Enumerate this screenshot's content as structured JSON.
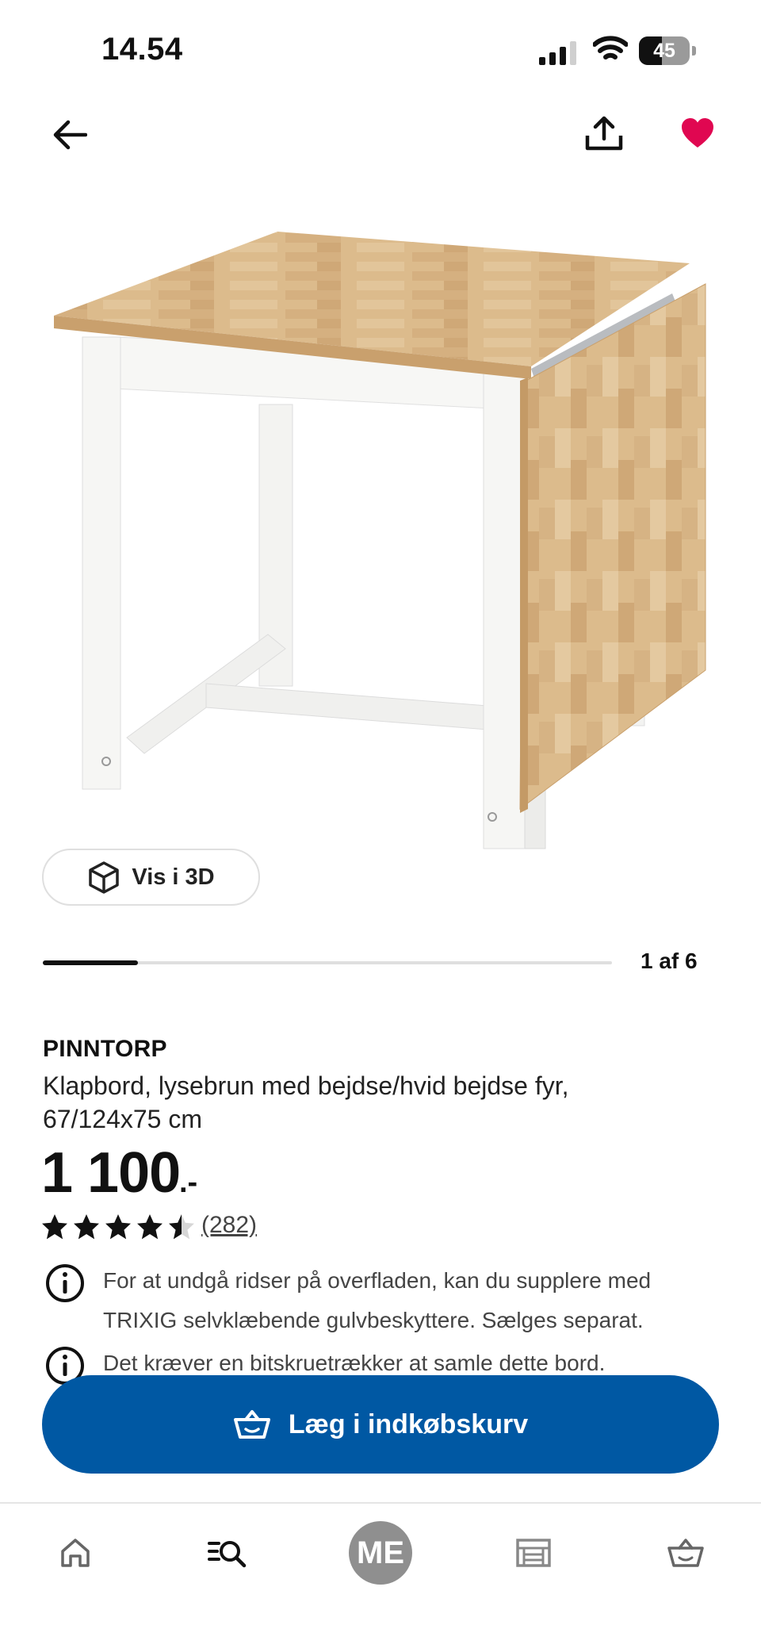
{
  "status_bar": {
    "time": "14.54",
    "battery": "45",
    "battery_level": 0.45
  },
  "nav": {
    "back_icon": "arrow-left-icon",
    "share_icon": "share-icon",
    "favorite_icon": "heart-icon",
    "favorite_active": true
  },
  "media": {
    "vis3d_label": "Vis i 3D",
    "counter": "1 af 6",
    "progress": 0.1667
  },
  "product": {
    "brand": "PINNTORP",
    "description": "Klapbord, lysebrun med bejdse/hvid bejdse fyr, 67/124x75 cm",
    "price": "1 100",
    "price_suffix": ".-",
    "rating": 4.5,
    "review_count": "(282)"
  },
  "notes": [
    "For at undgå ridser på overfladen, kan du supplere med TRIXIG selvklæbende gulvbeskyttere. Sælges separat.",
    "Det kræver en bitskruetrækker at samle dette bord."
  ],
  "cta": {
    "label": "Læg i indkøbskurv"
  },
  "tabbar": {
    "items": [
      {
        "name": "home",
        "icon": "home-icon"
      },
      {
        "name": "search",
        "icon": "search-list-icon"
      },
      {
        "name": "profile",
        "label": "ME"
      },
      {
        "name": "store",
        "icon": "store-icon"
      },
      {
        "name": "cart",
        "icon": "cart-icon"
      }
    ]
  },
  "colors": {
    "accent": "#0058a3",
    "favorite": "#e00751",
    "wood": "#d9b888",
    "frame": "#f4f4f2"
  }
}
